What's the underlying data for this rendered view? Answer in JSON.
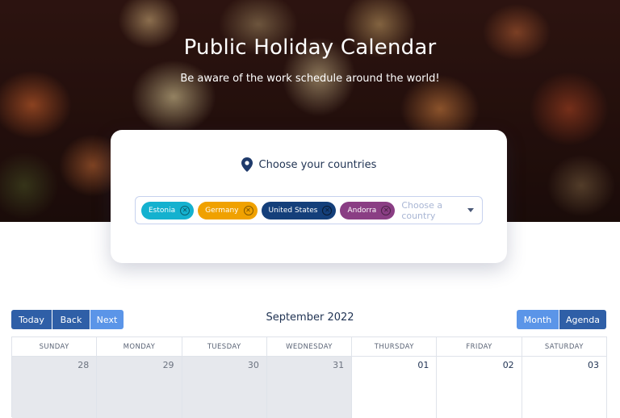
{
  "hero": {
    "title": "Public Holiday Calendar",
    "subtitle": "Be aware of the work schedule around the world!"
  },
  "selector": {
    "heading": "Choose your countries",
    "placeholder": "Choose a country",
    "chips": [
      {
        "label": "Estonia",
        "color": "#14b1cf"
      },
      {
        "label": "Germany",
        "color": "#f0a100"
      },
      {
        "label": "United States",
        "color": "#143f7a"
      },
      {
        "label": "Andorra",
        "color": "#8a3e84"
      }
    ]
  },
  "toolbar": {
    "today": "Today",
    "back": "Back",
    "next": "Next",
    "month_label": "September 2022",
    "month_view": "Month",
    "agenda_view": "Agenda"
  },
  "calendar": {
    "weekdays": [
      "SUNDAY",
      "MONDAY",
      "TUESDAY",
      "WEDNESDAY",
      "THURSDAY",
      "FRIDAY",
      "SATURDAY"
    ],
    "first_week": [
      {
        "day": "28",
        "outside": true
      },
      {
        "day": "29",
        "outside": true
      },
      {
        "day": "30",
        "outside": true
      },
      {
        "day": "31",
        "outside": true
      },
      {
        "day": "01",
        "outside": false
      },
      {
        "day": "02",
        "outside": false
      },
      {
        "day": "03",
        "outside": false
      }
    ]
  }
}
